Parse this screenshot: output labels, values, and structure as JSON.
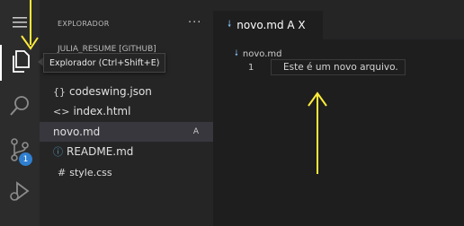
{
  "sidebar": {
    "title": "EXPLORADOR",
    "more_actions": "···",
    "folder_header": "JULIA_RESUME [GITHUB]",
    "files": {
      "codeswing": {
        "icon": "{}",
        "name": "codeswing.json"
      },
      "index": {
        "icon": "<>",
        "name": "index.html"
      },
      "novo": {
        "name": "novo.md",
        "badge": "A"
      },
      "readme": {
        "icon": "ⓘ",
        "name": "README.md"
      },
      "style": {
        "icon": "#",
        "name": "style.css"
      }
    }
  },
  "activity_bar": {
    "icons": [
      "menu-icon",
      "files-icon",
      "search-icon",
      "source-control-icon",
      "run-debug-icon"
    ],
    "scm_badge": "1"
  },
  "tooltip": {
    "text": "Explorador (Ctrl+Shift+E)"
  },
  "editor": {
    "tab_label": "novo.md A X",
    "breadcrumb": "novo.md",
    "lines": [
      {
        "number": "1",
        "text": "Este é um novo arquivo."
      }
    ]
  },
  "colors": {
    "accent": "#2f7fd1",
    "annotation": "#ffeb3b"
  }
}
